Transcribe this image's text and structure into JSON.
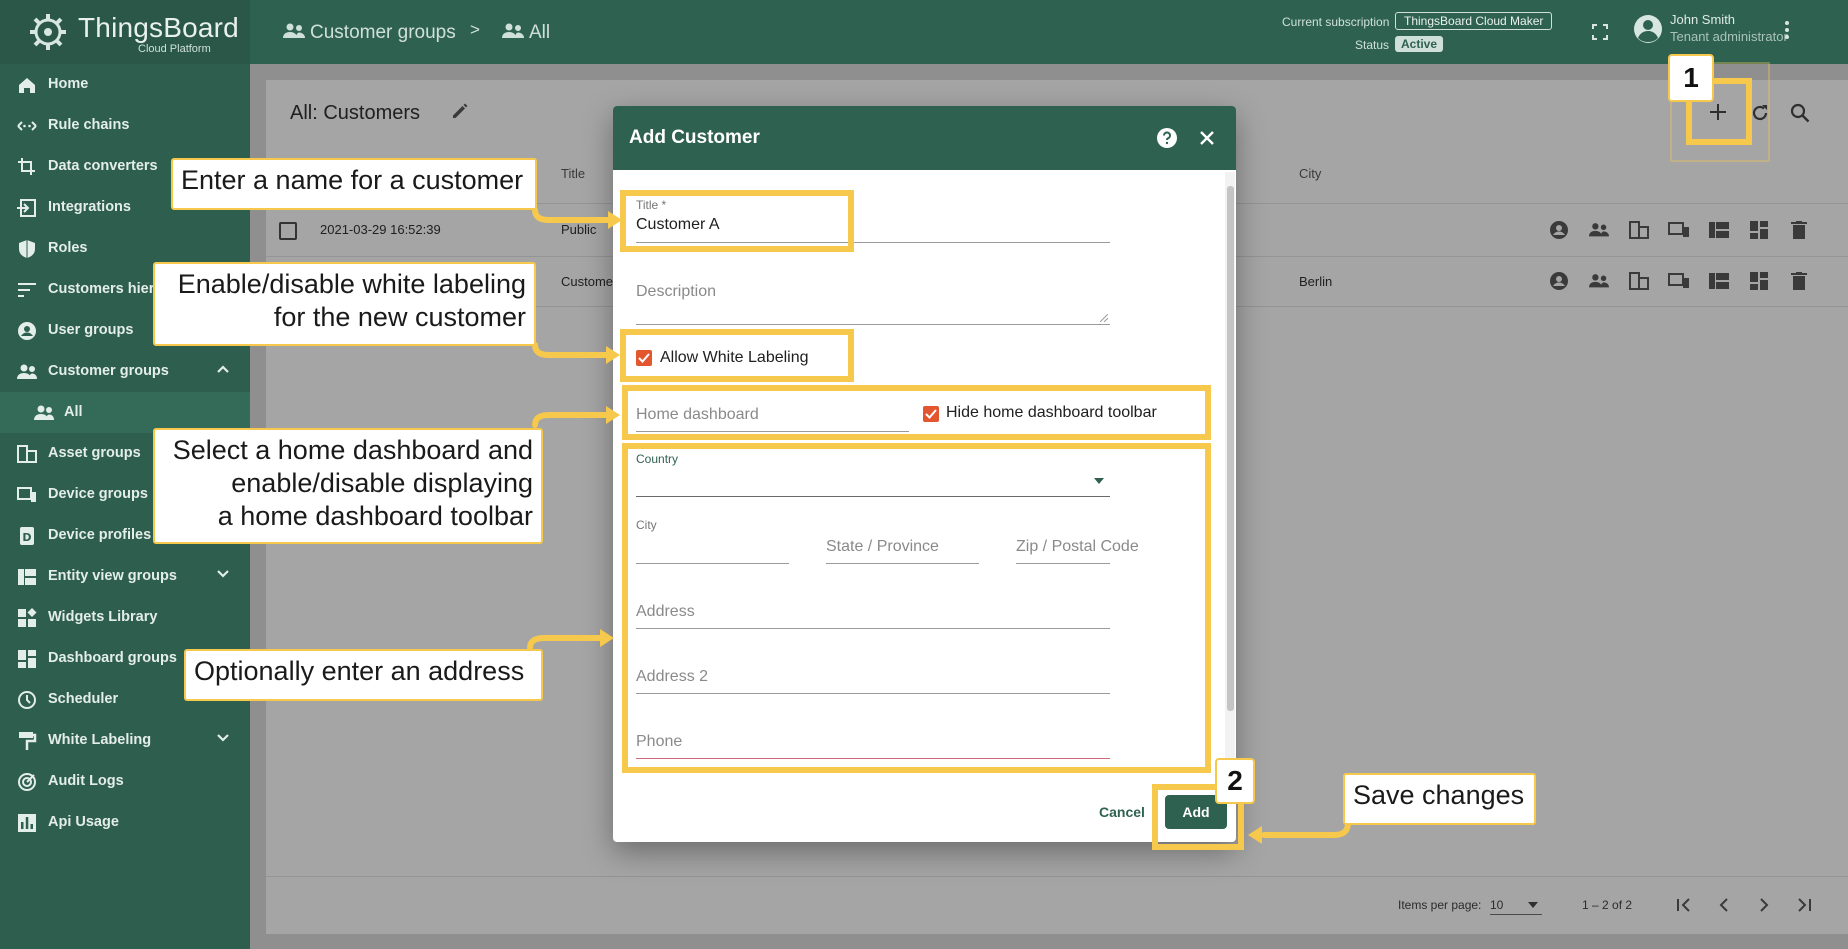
{
  "app": {
    "logo_title": "ThingsBoard",
    "logo_subtitle": "Cloud Platform"
  },
  "sidebar": {
    "items": [
      {
        "label": "Home",
        "icon": "home-icon"
      },
      {
        "label": "Rule chains",
        "icon": "rule-chains-icon"
      },
      {
        "label": "Data converters",
        "icon": "crop-icon"
      },
      {
        "label": "Integrations",
        "icon": "input-icon"
      },
      {
        "label": "Roles",
        "icon": "shield-icon"
      },
      {
        "label": "Customers hierarchy",
        "icon": "sort-icon"
      },
      {
        "label": "User groups",
        "icon": "account-circle-icon"
      },
      {
        "label": "Customer groups",
        "icon": "supervisor-icon"
      },
      {
        "label": "All",
        "icon": "supervisor-icon"
      },
      {
        "label": "Asset groups",
        "icon": "domain-icon"
      },
      {
        "label": "Device groups",
        "icon": "devices-icon"
      },
      {
        "label": "Device profiles",
        "icon": "device-profile-icon"
      },
      {
        "label": "Entity view groups",
        "icon": "view-quilt-icon"
      },
      {
        "label": "Widgets Library",
        "icon": "widgets-icon"
      },
      {
        "label": "Dashboard groups",
        "icon": "dashboard-icon"
      },
      {
        "label": "Scheduler",
        "icon": "schedule-icon"
      },
      {
        "label": "White Labeling",
        "icon": "format-paint-icon"
      },
      {
        "label": "Audit Logs",
        "icon": "track-changes-icon"
      },
      {
        "label": "Api Usage",
        "icon": "insert-chart-icon"
      }
    ]
  },
  "header": {
    "breadcrumb_1": "Customer groups",
    "breadcrumb_sep": ">",
    "breadcrumb_2": "All",
    "subscription_label": "Current subscription",
    "subscription_value": "ThingsBoard Cloud Maker",
    "status_label": "Status",
    "status_value": "Active",
    "user_name": "John Smith",
    "user_role": "Tenant administrator"
  },
  "table": {
    "title": "All: Customers",
    "col_title": "Title",
    "col_city": "City",
    "rows": [
      {
        "created": "2021-03-29 16:52:39",
        "title": "Public",
        "city": ""
      },
      {
        "created": "",
        "title": "Custome",
        "city": "Berlin"
      }
    ],
    "items_per_page_label": "Items per page:",
    "items_per_page_value": "10",
    "range": "1 – 2 of 2"
  },
  "dialog": {
    "title": "Add Customer",
    "title_field_label": "Title *",
    "title_field_value": "Customer A",
    "description_placeholder": "Description",
    "allow_white_labeling_label": "Allow White Labeling",
    "home_dashboard_placeholder": "Home dashboard",
    "hide_toolbar_label": "Hide home dashboard toolbar",
    "country_label": "Country",
    "city_label": "City",
    "state_placeholder": "State / Province",
    "zip_placeholder": "Zip / Postal Code",
    "address_placeholder": "Address",
    "address2_placeholder": "Address 2",
    "phone_placeholder": "Phone",
    "cancel_label": "Cancel",
    "add_label": "Add"
  },
  "annotations": {
    "step_1": "1",
    "step_2": "2",
    "callout_name": "Enter a name for a customer",
    "callout_wl_1": "Enable/disable white labeling",
    "callout_wl_2": "for the new customer",
    "callout_dash_1": "Select a home dashboard and",
    "callout_dash_2": "enable/disable displaying",
    "callout_dash_3": "a home dashboard toolbar",
    "callout_address": "Optionally enter an address",
    "callout_save": "Save changes"
  },
  "colors": {
    "primary": "#2f6150",
    "highlight": "#f6c84c",
    "checkbox": "#e25730"
  }
}
